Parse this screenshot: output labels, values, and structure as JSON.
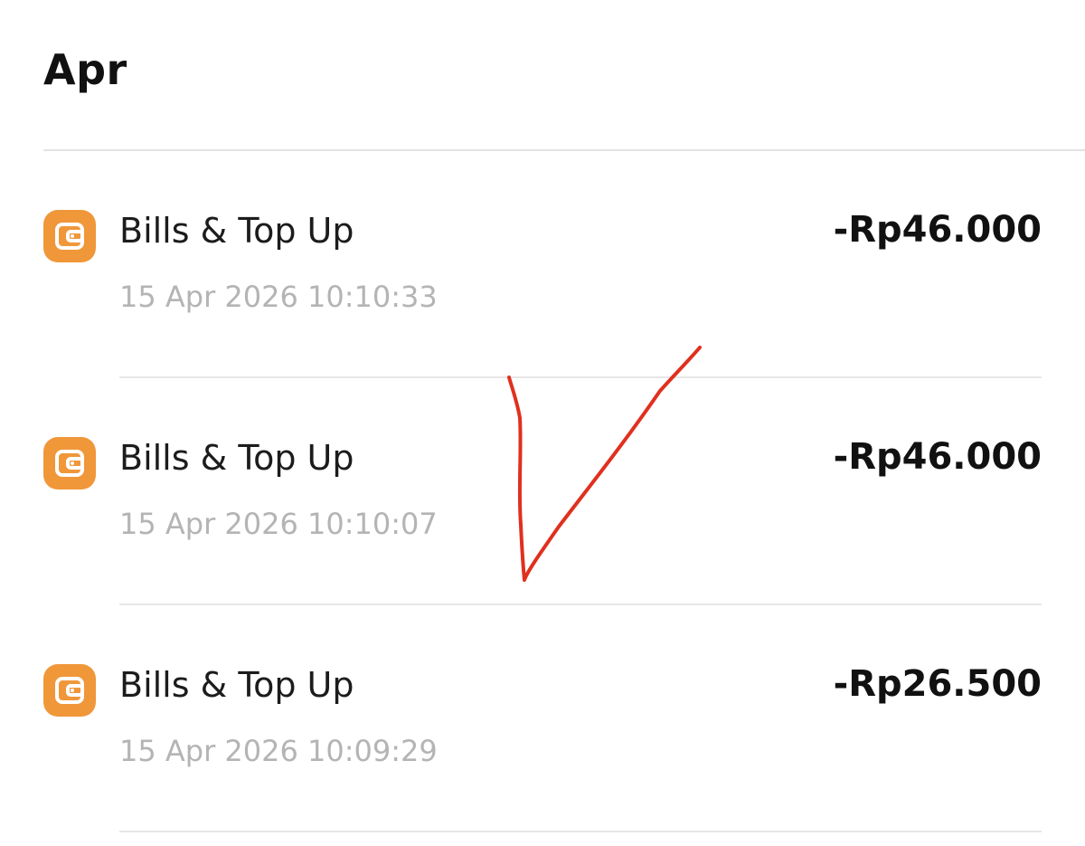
{
  "section": {
    "month": "Apr"
  },
  "transactions": [
    {
      "title": "Bills & Top Up",
      "datetime": "15 Apr 2026 10:10:33",
      "amount": "-Rp46.000",
      "icon": "wallet-icon"
    },
    {
      "title": "Bills & Top Up",
      "datetime": "15 Apr 2026 10:10:07",
      "amount": "-Rp46.000",
      "icon": "wallet-icon"
    },
    {
      "title": "Bills & Top Up",
      "datetime": "15 Apr 2026 10:09:29",
      "amount": "-Rp26.500",
      "icon": "wallet-icon"
    }
  ],
  "colors": {
    "icon_bg": "#f0973a",
    "annotation_mark": "#e0301e",
    "secondary_text": "#b4b4b4"
  },
  "annotation": {
    "type": "handwritten-checkmark",
    "icon": "checkmark-icon"
  }
}
